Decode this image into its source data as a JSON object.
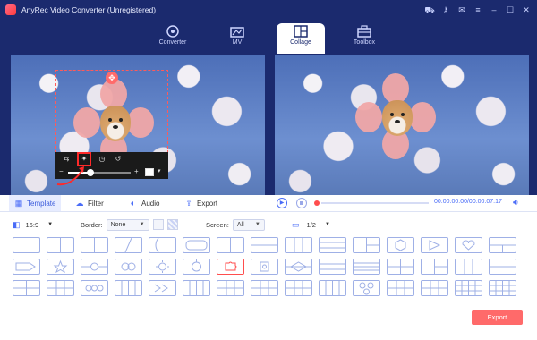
{
  "app": {
    "title": "AnyRec Video Converter (Unregistered)"
  },
  "window_icons": [
    "cart-icon",
    "key-icon",
    "message-icon",
    "menu-icon",
    "minimize-icon",
    "maximize-icon",
    "close-icon"
  ],
  "nav": {
    "tabs": [
      {
        "label": "Converter",
        "icon": "converter-icon"
      },
      {
        "label": "MV",
        "icon": "mv-icon"
      },
      {
        "label": "Collage",
        "icon": "collage-icon",
        "active": true
      },
      {
        "label": "Toolbox",
        "icon": "toolbox-icon"
      }
    ]
  },
  "editor": {
    "zoom_level": 0.35
  },
  "playback": {
    "time": "00:00:00.00/00:00:07.17"
  },
  "sub_tabs": [
    {
      "label": "Template",
      "icon": "grid-icon",
      "active": true
    },
    {
      "label": "Filter",
      "icon": "filter-icon"
    },
    {
      "label": "Audio",
      "icon": "audio-icon"
    },
    {
      "label": "Export",
      "icon": "export-icon"
    }
  ],
  "options": {
    "aspect": "16:9",
    "border_label": "Border:",
    "border_value": "None",
    "screen_label": "Screen:",
    "screen_value": "All",
    "page": "1/2"
  },
  "export_button": "Export",
  "colors": {
    "brand": "#1b2a6e",
    "accent": "#4a6cf7",
    "export": "#ff6a6a",
    "selected": "#ff4d4d"
  }
}
